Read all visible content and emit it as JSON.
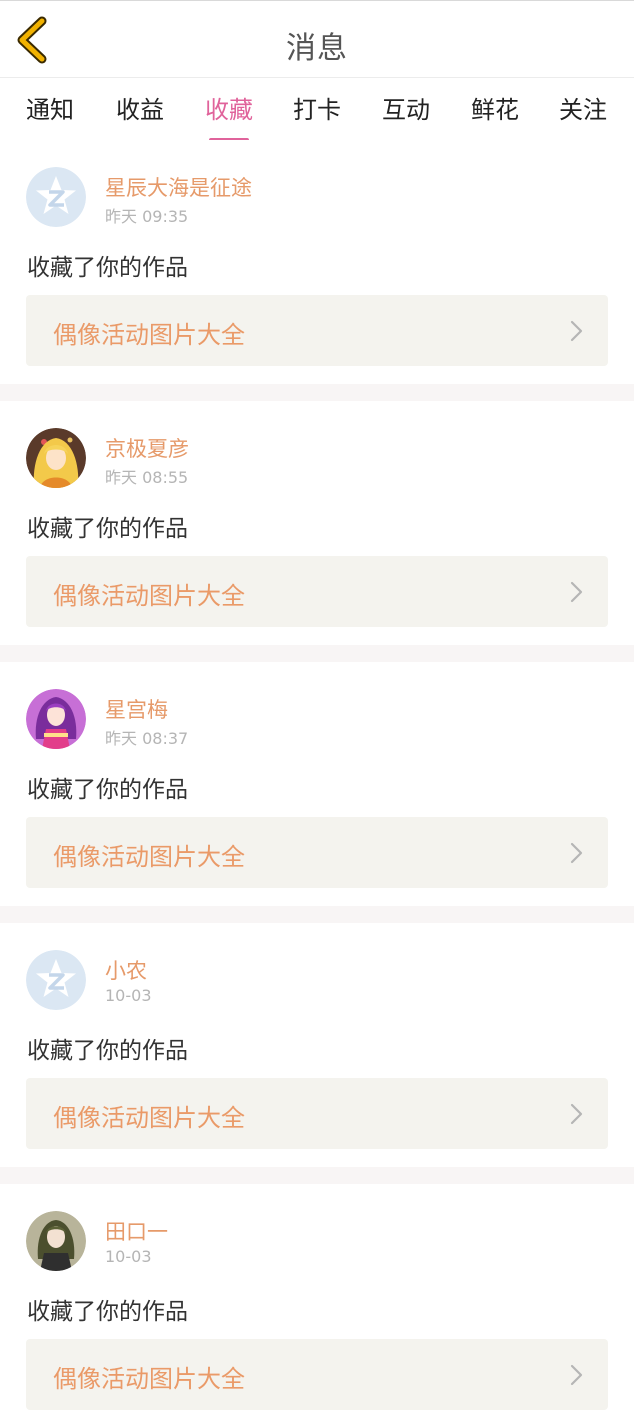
{
  "header": {
    "title": "消息",
    "back_icon": "chevron-left-icon",
    "back_color": "#f0a500"
  },
  "tabs": [
    {
      "label": "通知",
      "active": false
    },
    {
      "label": "收益",
      "active": false
    },
    {
      "label": "收藏",
      "active": true
    },
    {
      "label": "打卡",
      "active": false
    },
    {
      "label": "互动",
      "active": false
    },
    {
      "label": "鲜花",
      "active": false
    },
    {
      "label": "关注",
      "active": false
    }
  ],
  "colors": {
    "accent": "#e0639b",
    "username": "#e69a6a",
    "work_title": "#ea9a68",
    "work_box_bg": "#f4f3ee"
  },
  "feed": {
    "items": [
      {
        "user": "星辰大海是征途",
        "time": "昨天 09:35",
        "action": "收藏了你的作品",
        "work": "偶像活动图片大全",
        "avatar": "default-star-avatar"
      },
      {
        "user": "京极夏彦",
        "time": "昨天 08:55",
        "action": "收藏了你的作品",
        "work": "偶像活动图片大全",
        "avatar": "anime-girl-yellow-avatar"
      },
      {
        "user": "星宫梅",
        "time": "昨天 08:37",
        "action": "收藏了你的作品",
        "work": "偶像活动图片大全",
        "avatar": "anime-girl-purple-avatar"
      },
      {
        "user": "小农",
        "time": "10-03",
        "action": "收藏了你的作品",
        "work": "偶像活动图片大全",
        "avatar": "default-star-avatar"
      },
      {
        "user": "田口一",
        "time": "10-03",
        "action": "收藏了你的作品",
        "work": "偶像活动图片大全",
        "avatar": "anime-girl-dark-avatar"
      }
    ]
  }
}
